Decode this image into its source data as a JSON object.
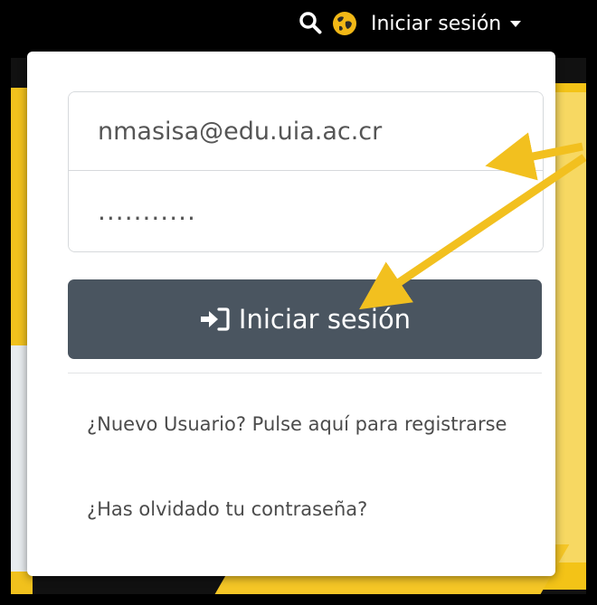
{
  "nav": {
    "icons": [
      "search-icon",
      "globe-icon",
      "caret-down-icon"
    ],
    "login_label": "Iniciar sesión"
  },
  "login_form": {
    "email_value": "nmasisa@edu.uia.ac.cr",
    "password_value": "...........",
    "submit_label": "Iniciar sesión",
    "submit_icon": "sign-in-icon",
    "register_link": "¿Nuevo Usuario? Pulse aquí para registrarse",
    "forgot_link": "¿Has olvidado tu contraseña?"
  },
  "colors": {
    "button": "#4a5560",
    "annotation_arrow": "#f2c01f",
    "nav_background": "#000000"
  }
}
